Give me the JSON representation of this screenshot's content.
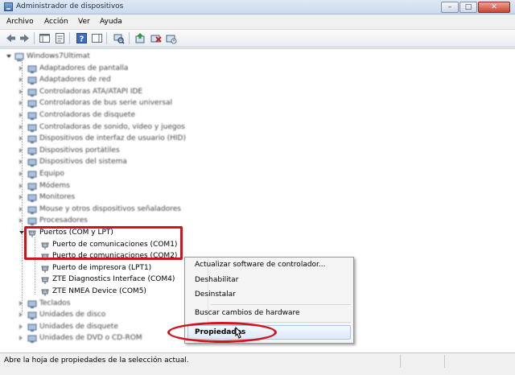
{
  "window": {
    "title": "Administrador de dispositivos",
    "min": "–",
    "max": "□",
    "close": "✕"
  },
  "menu": [
    "Archivo",
    "Acción",
    "Ver",
    "Ayuda"
  ],
  "tree": {
    "root": "Windows7Ultimat",
    "categories": [
      "Adaptadores de pantalla",
      "Adaptadores de red",
      "Controladoras ATA/ATAPI IDE",
      "Controladoras de bus serie universal",
      "Controladoras de disquete",
      "Controladoras de sonido, vídeo y juegos",
      "Dispositivos de interfaz de usuario (HID)",
      "Dispositivos portátiles",
      "Dispositivos del sistema",
      "Equipo",
      "Módems",
      "Monitores",
      "Mouse y otros dispositivos señaladores",
      "Procesadores"
    ],
    "ports": {
      "label": "Puertos (COM y LPT)",
      "children": [
        "Puerto de comunicaciones (COM1)",
        "Puerto de comunicaciones (COM2)",
        "Puerto de impresora (LPT1)",
        "ZTE Diagnostics Interface (COM4)",
        "ZTE NMEA Device (COM5)"
      ]
    },
    "after": [
      "Teclados",
      "Unidades de disco",
      "Unidades de disquete",
      "Unidades de DVD o CD-ROM"
    ]
  },
  "context_menu": {
    "items": [
      "Actualizar software de controlador...",
      "Deshabilitar",
      "Desinstalar",
      "Buscar cambios de hardware",
      "Propiedades"
    ]
  },
  "status": {
    "text": "Abre la hoja de propiedades de la selección actual."
  },
  "colors": {
    "annotation_red": "#d4141b",
    "menu_highlight": "#dde9f8"
  }
}
